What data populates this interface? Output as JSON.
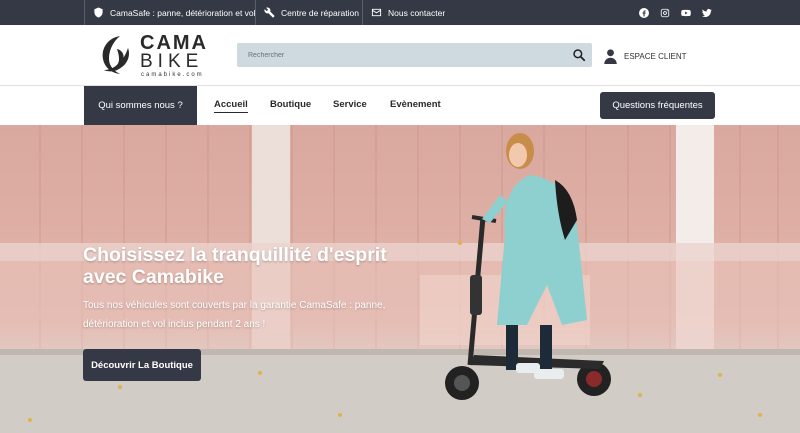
{
  "topbar": {
    "items": [
      {
        "icon": "shield-icon",
        "label": "CamaSafe : panne, détérioration et vol"
      },
      {
        "icon": "wrench-icon",
        "label": "Centre de réparation"
      },
      {
        "icon": "mail-icon",
        "label": "Nous contacter"
      }
    ],
    "social": [
      "facebook-icon",
      "instagram-icon",
      "youtube-icon",
      "twitter-icon"
    ]
  },
  "header": {
    "logo": {
      "line1": "CAMA",
      "line2": "BIKE",
      "domain": "camabike.com"
    },
    "search": {
      "placeholder": "Rechercher",
      "value": ""
    },
    "client_label": "ESPACE CLIENT"
  },
  "nav": {
    "who_label": "Qui sommes nous ?",
    "links": [
      "Accueil",
      "Boutique",
      "Service",
      "Evènement"
    ],
    "active": "Accueil",
    "faq_label": "Questions fréquentes"
  },
  "hero": {
    "title": "Choisissez la tranquillité d'esprit avec Camabike",
    "subtitle": "Tous nos véhicules sont couverts par la garantie CamaSafe : panne, détérioration et vol inclus pendant 2 ans !",
    "button_label": "Découvrir La Boutique"
  },
  "colors": {
    "dark": "#353946",
    "search_bg": "#cfd9e0",
    "wall": "#dfb0a6",
    "coat": "#8ecfd0"
  }
}
